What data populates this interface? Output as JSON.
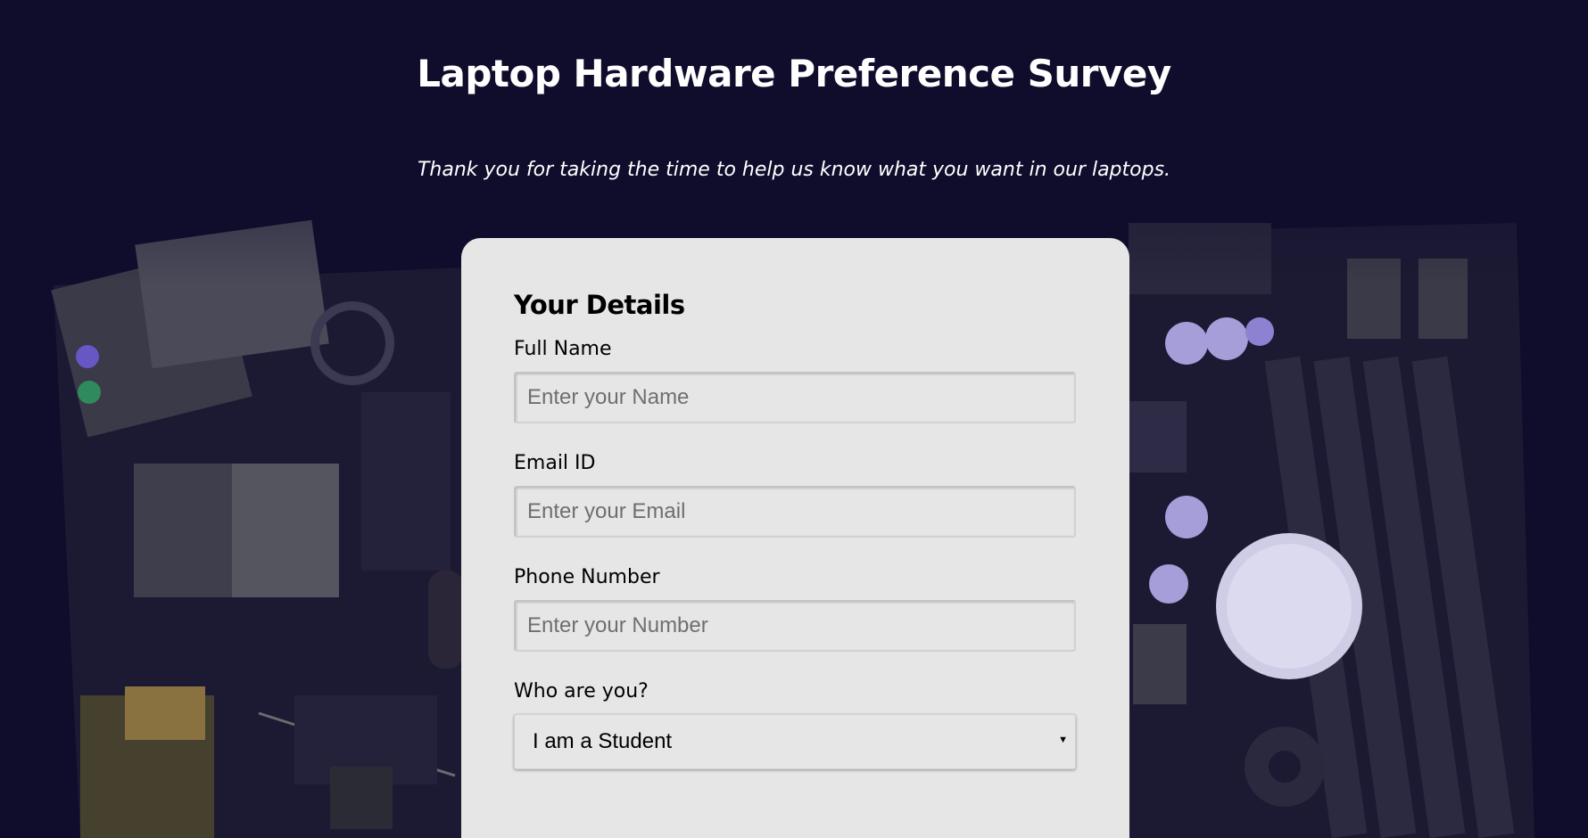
{
  "page": {
    "title": "Laptop Hardware Preference Survey",
    "subtitle": "Thank you for taking the time to help us know what you want in our laptops."
  },
  "form": {
    "section_heading": "Your Details",
    "fields": {
      "name": {
        "label": "Full Name",
        "placeholder": "Enter your Name"
      },
      "email": {
        "label": "Email ID",
        "placeholder": "Enter your Email"
      },
      "phone": {
        "label": "Phone Number",
        "placeholder": "Enter your Number"
      },
      "role": {
        "label": "Who are you?",
        "selected": "I am a Student"
      }
    }
  },
  "icons": {
    "select_arrow": "chevron-down-icon"
  },
  "colors": {
    "background": "#0f0c2c",
    "card": "#e6e6e6",
    "accent_purple": "#7b6fd0"
  }
}
